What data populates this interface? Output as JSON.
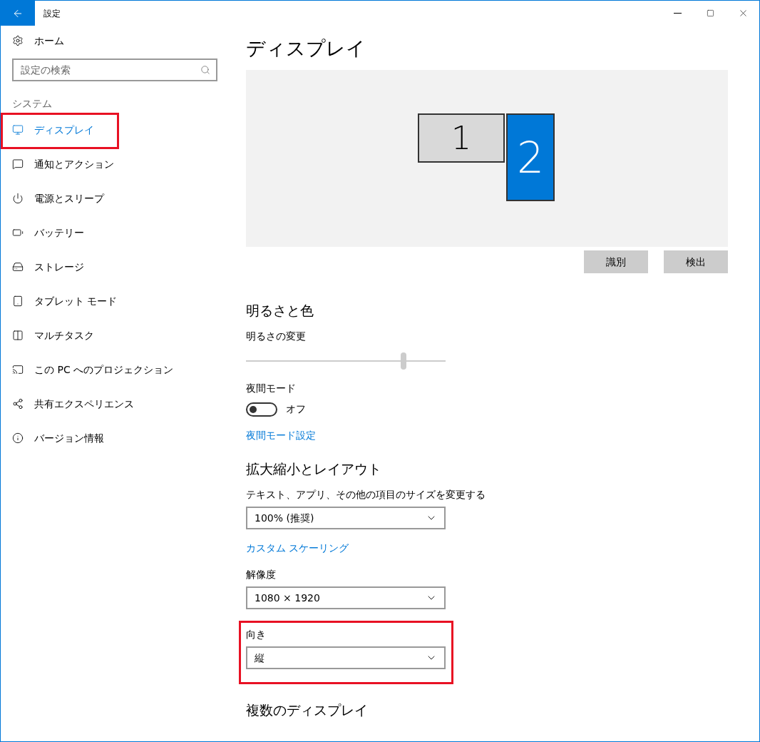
{
  "window": {
    "title": "設定"
  },
  "sidebar": {
    "home": "ホーム",
    "search": {
      "placeholder": "設定の検索"
    },
    "section": "システム",
    "items": [
      {
        "label": "ディスプレイ",
        "selected": true,
        "annotated": true
      },
      {
        "label": "通知とアクション",
        "selected": false,
        "annotated": false
      },
      {
        "label": "電源とスリープ",
        "selected": false,
        "annotated": false
      },
      {
        "label": "バッテリー",
        "selected": false,
        "annotated": false
      },
      {
        "label": "ストレージ",
        "selected": false,
        "annotated": false
      },
      {
        "label": "タブレット モード",
        "selected": false,
        "annotated": false
      },
      {
        "label": "マルチタスク",
        "selected": false,
        "annotated": false
      },
      {
        "label": "この PC へのプロジェクション",
        "selected": false,
        "annotated": false
      },
      {
        "label": "共有エクスペリエンス",
        "selected": false,
        "annotated": false
      },
      {
        "label": "バージョン情報",
        "selected": false,
        "annotated": false
      }
    ]
  },
  "page": {
    "title": "ディスプレイ",
    "monitors": [
      {
        "label": "1",
        "selected": false
      },
      {
        "label": "2",
        "selected": true
      }
    ],
    "buttons": [
      "識別",
      "検出"
    ],
    "sections": [
      {
        "heading": "明るさと色",
        "items": [
          {
            "kind": "slider",
            "label": "明るさの変更",
            "level": 0.79
          },
          {
            "kind": "toggle",
            "label": "夜間モード",
            "on": false,
            "state_text": "オフ"
          },
          {
            "kind": "link",
            "label": "夜間モード設定"
          }
        ]
      },
      {
        "heading": "拡大縮小とレイアウト",
        "items": [
          {
            "kind": "dropdown",
            "label": "テキスト、アプリ、その他の項目のサイズを変更する",
            "value": "100% (推奨)",
            "annotated": false
          },
          {
            "kind": "link",
            "label": "カスタム スケーリング"
          },
          {
            "kind": "dropdown",
            "label": "解像度",
            "value": "1080 × 1920",
            "annotated": false
          },
          {
            "kind": "dropdown",
            "label": "向き",
            "value": "縦",
            "annotated": true
          }
        ]
      },
      {
        "heading": "複数のディスプレイ"
      }
    ]
  }
}
